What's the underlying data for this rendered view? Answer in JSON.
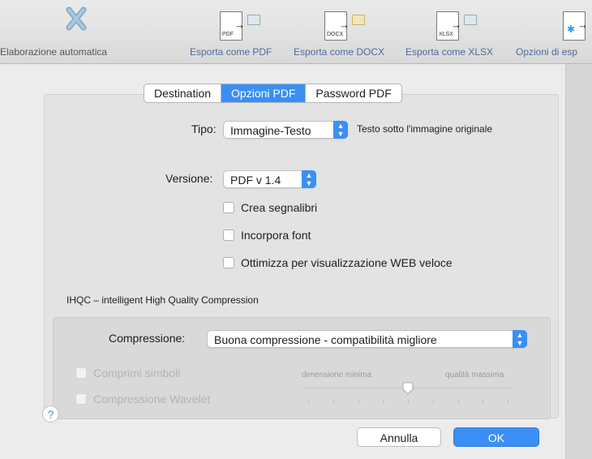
{
  "toolbar": {
    "items": [
      {
        "label": "Elaborazione automatica",
        "icon": "auto-processing-icon"
      },
      {
        "label": "Esporta come PDF",
        "tag": "PDF",
        "icon": "export-pdf-icon"
      },
      {
        "label": "Esporta come DOCX",
        "tag": "DOCX",
        "icon": "export-docx-icon"
      },
      {
        "label": "Esporta come XLSX",
        "tag": "XLSX",
        "icon": "export-xlsx-icon"
      },
      {
        "label": "Opzioni di esp",
        "icon": "export-options-icon"
      }
    ]
  },
  "tabs": [
    {
      "label": "Destination",
      "active": false
    },
    {
      "label": "Opzioni PDF",
      "active": true
    },
    {
      "label": "Password PDF",
      "active": false
    }
  ],
  "tipo": {
    "label": "Tipo:",
    "value": "Immagine-Testo",
    "description": "Testo sotto l'immagine originale"
  },
  "versione": {
    "label": "Versione:",
    "value": "PDF v 1.4"
  },
  "checkboxes": [
    {
      "label": "Crea segnalibri",
      "checked": false
    },
    {
      "label": "Incorpora font",
      "checked": false
    },
    {
      "label": "Ottimizza per visualizzazione WEB veloce",
      "checked": false
    }
  ],
  "ihqc": {
    "title": "IHQC – intelligent High Quality Compression",
    "compression_label": "Compressione:",
    "compression_value": "Buona compressione - compatibilità migliore",
    "options": [
      {
        "label": "Comprimi simboli",
        "checked": false,
        "enabled": false
      },
      {
        "label": "Compressione Wavelet",
        "checked": false,
        "enabled": false
      }
    ],
    "slider": {
      "min_label": "dimensione minima",
      "max_label": "qualità massima",
      "value_fraction": 0.5,
      "ticks": 9
    }
  },
  "buttons": {
    "help": "?",
    "cancel": "Annulla",
    "ok": "OK"
  },
  "colors": {
    "accent": "#3a8ff5",
    "link": "#4a6b9a"
  }
}
